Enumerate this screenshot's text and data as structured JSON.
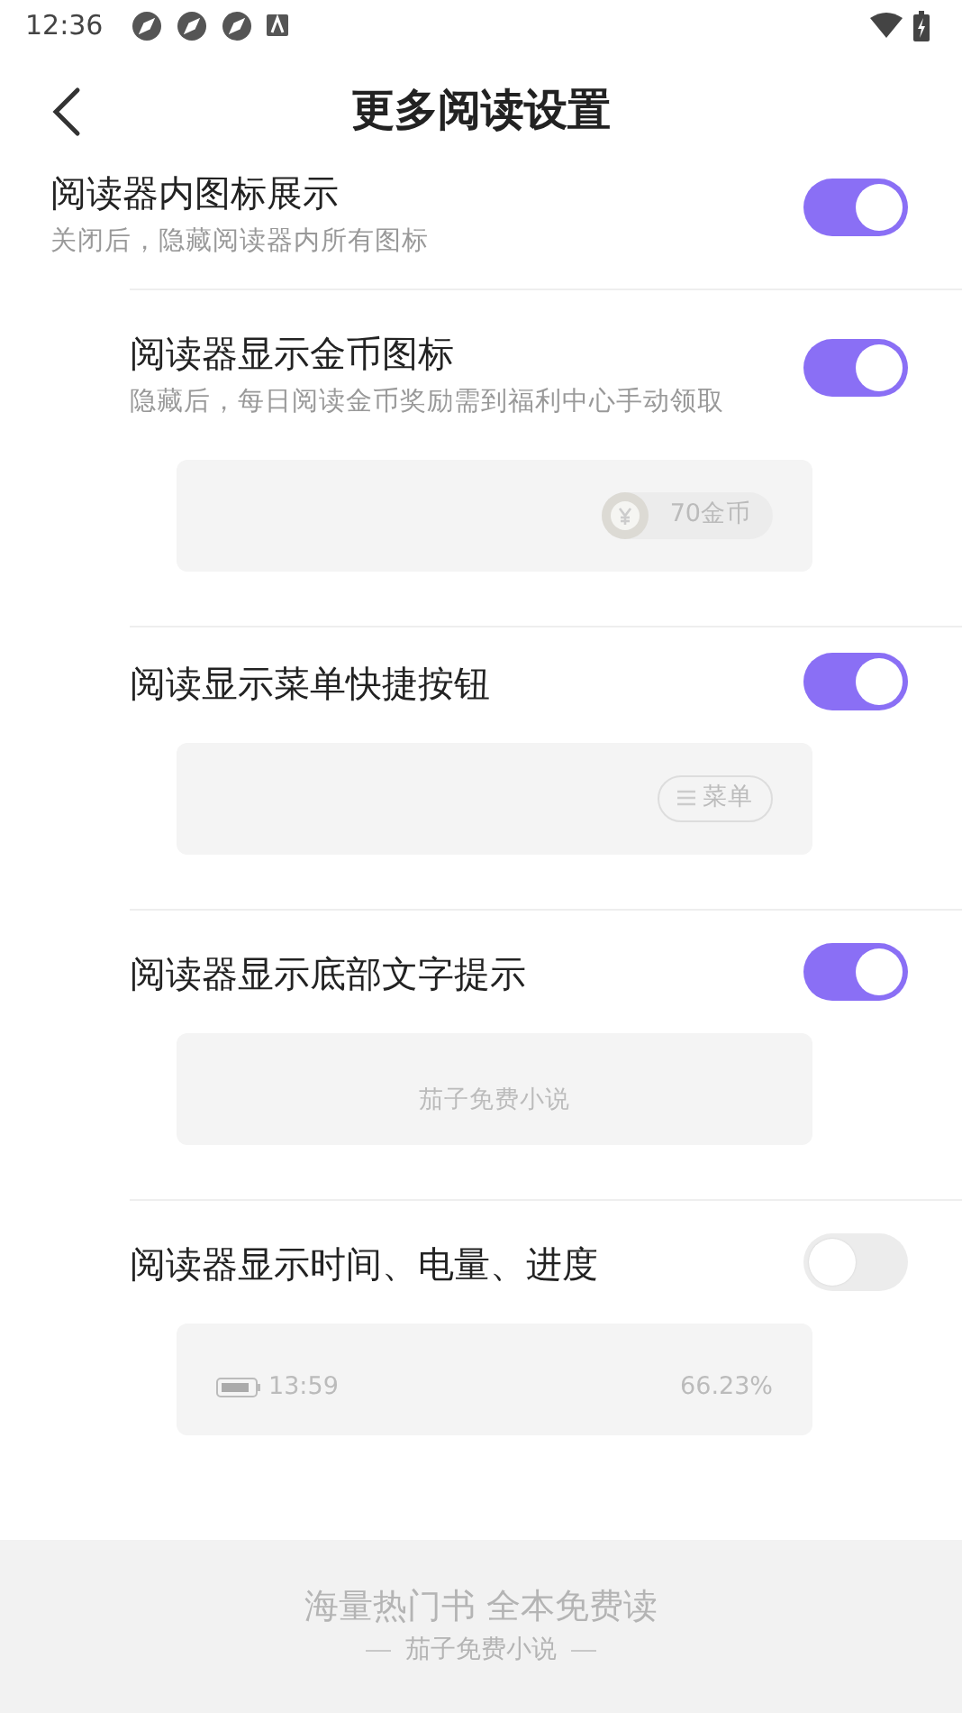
{
  "status_bar": {
    "time": "12:36"
  },
  "header": {
    "title": "更多阅读设置"
  },
  "main_setting": {
    "title": "阅读器内图标展示",
    "description": "关闭后，隐藏阅读器内所有图标",
    "on": true
  },
  "sub_settings": [
    {
      "title": "阅读器显示金币图标",
      "description": "隐藏后，每日阅读金币奖励需到福利中心手动领取",
      "on": true,
      "preview": {
        "kind": "coin",
        "text": "70金币"
      }
    },
    {
      "title": "阅读显示菜单快捷按钮",
      "on": true,
      "preview": {
        "kind": "menu",
        "text": "菜单"
      }
    },
    {
      "title": "阅读器显示底部文字提示",
      "on": true,
      "preview": {
        "kind": "caption",
        "text": "茄子免费小说"
      }
    },
    {
      "title": "阅读器显示时间、电量、进度",
      "on": false,
      "preview": {
        "kind": "status",
        "time": "13:59",
        "progress": "66.23%"
      }
    }
  ],
  "footer": {
    "headline": "海量热门书 全本免费读",
    "subline": "茄子免费小说"
  }
}
